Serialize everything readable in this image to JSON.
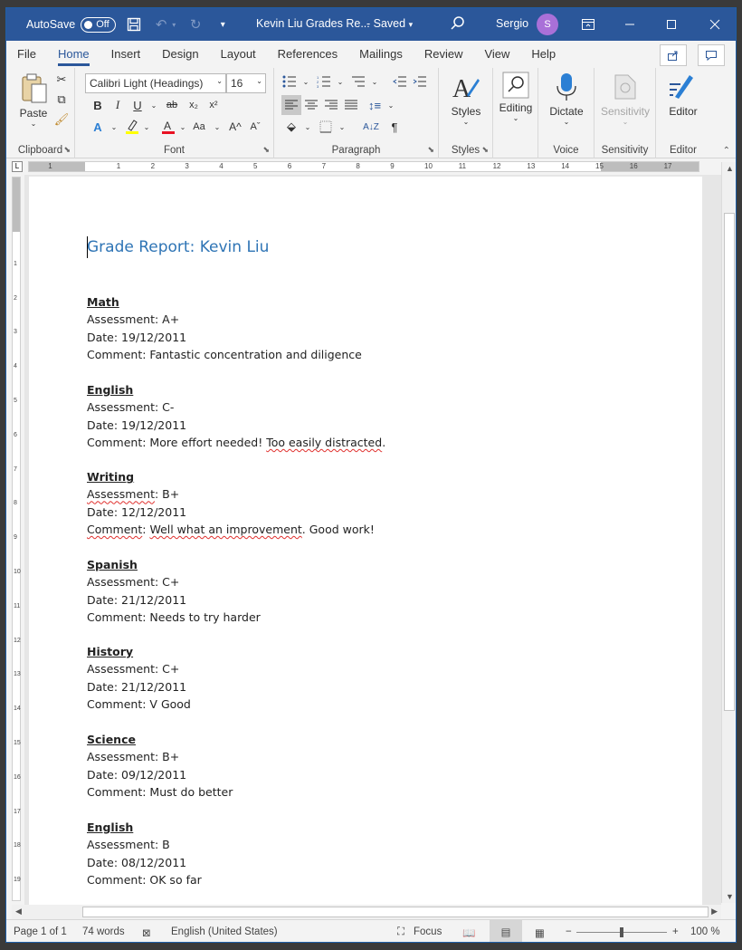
{
  "titlebar": {
    "autosave_label": "AutoSave",
    "autosave_state": "Off",
    "doc_title": "Kevin Liu Grades Re...",
    "saved_status": "-  Saved",
    "user_name": "Sergio",
    "avatar_initial": "S"
  },
  "tabs": [
    "File",
    "Home",
    "Insert",
    "Design",
    "Layout",
    "References",
    "Mailings",
    "Review",
    "View",
    "Help"
  ],
  "ribbon": {
    "paste_label": "Paste",
    "font_name": "Calibri Light (Headings)",
    "font_size": "16",
    "styles_label": "Styles",
    "editing_label": "Editing",
    "dictate_label": "Dictate",
    "sensitivity_label": "Sensitivity",
    "editor_label": "Editor",
    "groups": {
      "clipboard": "Clipboard",
      "font": "Font",
      "paragraph": "Paragraph",
      "styles": "Styles",
      "voice": "Voice",
      "sensitivity": "Sensitivity",
      "editor": "Editor"
    }
  },
  "document": {
    "title": "Grade Report: Kevin Liu",
    "sections": [
      {
        "subject": "Math",
        "assessment": "Assessment: A+",
        "date": "Date: 19/12/2011",
        "comment": "Comment: Fantastic concentration and diligence"
      },
      {
        "subject": "English",
        "assessment": "Assessment: C-",
        "date": "Date: 19/12/2011",
        "comment_a": "Comment: More effort needed! ",
        "comment_b": "Too easily distracted",
        "comment_c": "."
      },
      {
        "subject": "Writing",
        "assessment_a": "Assessment",
        "assessment_b": ": B+",
        "date": "Date: 12/12/2011",
        "comment_a": "Comment",
        "comment_b": ": ",
        "comment_c": "Well what an improvement",
        "comment_d": ". Good work!"
      },
      {
        "subject": "Spanish",
        "assessment": "Assessment: C+",
        "date": "Date: 21/12/2011",
        "comment": "Comment: Needs to try harder"
      },
      {
        "subject": "History",
        "assessment": "Assessment: C+",
        "date": "Date: 21/12/2011",
        "comment": "Comment: V Good"
      },
      {
        "subject": "Science",
        "assessment": "Assessment: B+",
        "date": "Date: 09/12/2011",
        "comment": "Comment: Must do better"
      },
      {
        "subject": "English",
        "assessment": "Assessment: B",
        "date": "Date: 08/12/2011",
        "comment": "Comment: OK so far"
      }
    ]
  },
  "ruler": {
    "h_ticks": [
      "1",
      "1",
      "2",
      "3",
      "4",
      "5",
      "6",
      "7",
      "8",
      "9",
      "10",
      "11",
      "12",
      "13",
      "14",
      "15",
      "16",
      "17"
    ],
    "v_ticks": [
      "1",
      "2",
      "3",
      "4",
      "5",
      "6",
      "7",
      "8",
      "9",
      "10",
      "11",
      "12",
      "13",
      "14",
      "15",
      "16",
      "17",
      "18",
      "19"
    ]
  },
  "status": {
    "page": "Page 1 of 1",
    "words": "74 words",
    "language": "English (United States)",
    "focus": "Focus",
    "zoom": "100 %"
  },
  "colors": {
    "titlebar": "#2b579a",
    "heading": "#2e74b5",
    "spell_error": "#e0302e"
  }
}
